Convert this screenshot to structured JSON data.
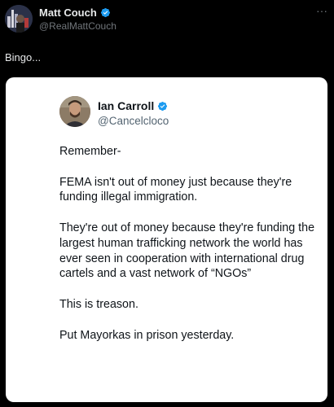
{
  "outer_tweet": {
    "author_name": "Matt Couch",
    "author_handle": "@RealMattCouch",
    "more_label": "···",
    "text": "Bingo..."
  },
  "quoted_screenshot": {
    "author_name": "Ian Carroll",
    "author_handle": "@Cancelcloco",
    "paragraphs": [
      "Remember-",
      "FEMA isn't out of money just because they're funding illegal immigration.",
      "They're out of money because they're funding the largest human trafficking network the world has ever seen in cooperation with international drug cartels and a vast network of “NGOs”",
      "This is treason.",
      "Put Mayorkas in prison yesterday."
    ]
  },
  "colors": {
    "background": "#000000",
    "verified_badge": "#1d9bf0",
    "card_background": "#ffffff"
  },
  "icons": [
    "verified-badge-icon",
    "more-options-icon"
  ]
}
